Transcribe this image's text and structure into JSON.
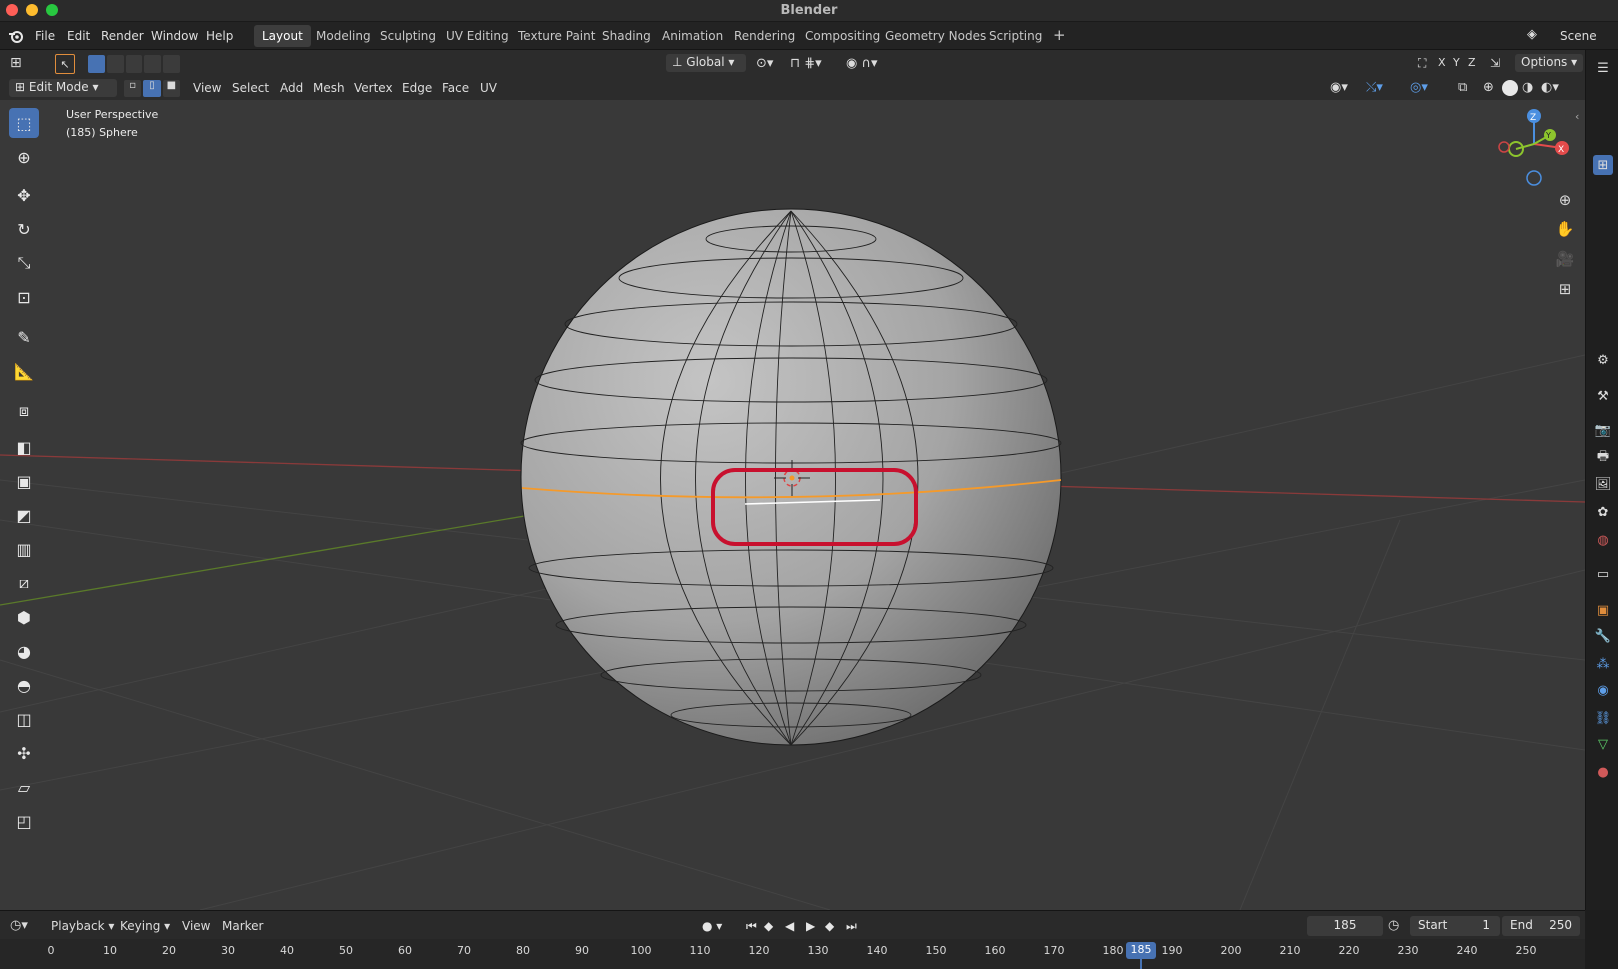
{
  "window": {
    "title": "Blender"
  },
  "menu": {
    "file": "File",
    "edit": "Edit",
    "render": "Render",
    "window": "Window",
    "help": "Help"
  },
  "workspaces": [
    "Layout",
    "Modeling",
    "Sculpting",
    "UV Editing",
    "Texture Paint",
    "Shading",
    "Animation",
    "Rendering",
    "Compositing",
    "Geometry Nodes",
    "Scripting"
  ],
  "scene": "Scene",
  "toolbar": {
    "orientation": "Global",
    "options": "Options",
    "axes": [
      "X",
      "Y",
      "Z"
    ]
  },
  "header": {
    "mode": "Edit Mode",
    "menus": [
      "View",
      "Select",
      "Add",
      "Mesh",
      "Vertex",
      "Edge",
      "Face",
      "UV"
    ]
  },
  "viewport": {
    "perspective": "User Perspective",
    "object": "(185) Sphere",
    "gizmo": {
      "z": "Z",
      "y": "Y",
      "x": "X"
    }
  },
  "timeline": {
    "menus": [
      "Playback",
      "Keying",
      "View",
      "Marker"
    ],
    "current_frame": "185",
    "start_label": "Start",
    "start": "1",
    "end_label": "End",
    "end": "250",
    "ticks": [
      "0",
      "10",
      "20",
      "30",
      "40",
      "50",
      "60",
      "70",
      "80",
      "90",
      "100",
      "110",
      "120",
      "130",
      "140",
      "150",
      "160",
      "170",
      "180",
      "185",
      "190",
      "200",
      "210",
      "220",
      "230",
      "240",
      "250"
    ]
  },
  "colors": {
    "accent": "#4772b3",
    "highlight_ring": "#c8102e",
    "selected_edge": "#f59a2a"
  }
}
